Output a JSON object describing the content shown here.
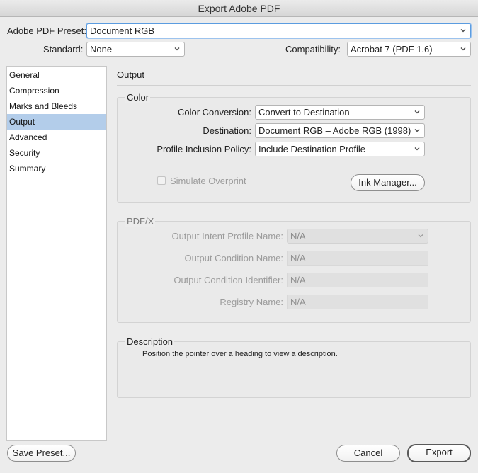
{
  "window": {
    "title": "Export Adobe PDF"
  },
  "top": {
    "preset_label": "Adobe PDF Preset:",
    "preset_value": "Document RGB",
    "standard_label": "Standard:",
    "standard_value": "None",
    "compat_label": "Compatibility:",
    "compat_value": "Acrobat 7 (PDF 1.6)"
  },
  "sidebar": {
    "items": [
      {
        "label": "General"
      },
      {
        "label": "Compression"
      },
      {
        "label": "Marks and Bleeds"
      },
      {
        "label": "Output",
        "selected": true
      },
      {
        "label": "Advanced"
      },
      {
        "label": "Security"
      },
      {
        "label": "Summary"
      }
    ]
  },
  "main": {
    "title": "Output",
    "color": {
      "title": "Color",
      "conversion_label": "Color Conversion:",
      "conversion_value": "Convert to Destination",
      "destination_label": "Destination:",
      "destination_value": "Document RGB – Adobe RGB (1998)",
      "policy_label": "Profile Inclusion Policy:",
      "policy_value": "Include Destination Profile",
      "simulate_label": "Simulate Overprint",
      "simulate_checked": false,
      "ink_button": "Ink Manager..."
    },
    "pdfx": {
      "title": "PDF/X",
      "intent_label": "Output Intent Profile Name:",
      "intent_value": "N/A",
      "condition_name_label": "Output Condition Name:",
      "condition_name_value": "N/A",
      "condition_id_label": "Output Condition Identifier:",
      "condition_id_value": "N/A",
      "registry_label": "Registry Name:",
      "registry_value": "N/A"
    },
    "description": {
      "title": "Description",
      "text": "Position the pointer over a heading to view a description."
    }
  },
  "footer": {
    "save_preset": "Save Preset...",
    "cancel": "Cancel",
    "export": "Export"
  }
}
